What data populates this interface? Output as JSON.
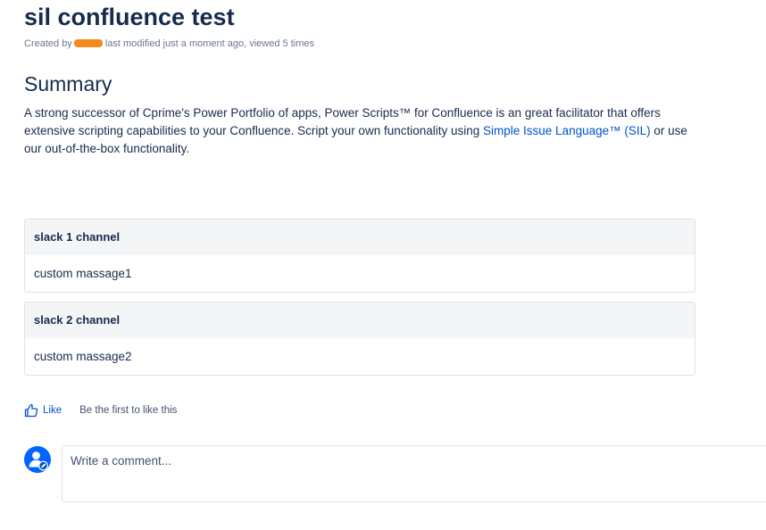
{
  "page": {
    "title": "sil confluence test",
    "meta": {
      "created_by_label": "Created by",
      "modified_text": "last modified just a moment ago, viewed 5 times"
    }
  },
  "summary": {
    "heading": "Summary",
    "text_before_link": "A strong successor of Cprime's Power Portfolio of apps, Power Scripts™ for Confluence is an great facilitator that offers extensive scripting capabilities to your Confluence. Script your own functionality using ",
    "link_text": "Simple Issue Language™ (SIL)",
    "text_after_link": " or use our out-of-the-box functionality."
  },
  "panels": [
    {
      "title": "slack 1 channel",
      "body": "custom massage1"
    },
    {
      "title": "slack 2 channel",
      "body": "custom massage2"
    }
  ],
  "likes": {
    "like_label": "Like",
    "hint": "Be the first to like this",
    "icon": "thumbs-up-icon"
  },
  "comment": {
    "placeholder": "Write a comment...",
    "avatar_icon": "user-avatar-icon"
  },
  "colors": {
    "text": "#172B4D",
    "link": "#0052CC",
    "meta": "#6B778C",
    "panel_header_bg": "#F4F5F7",
    "border": "#DFE1E6",
    "redaction": "#F28A1D"
  }
}
